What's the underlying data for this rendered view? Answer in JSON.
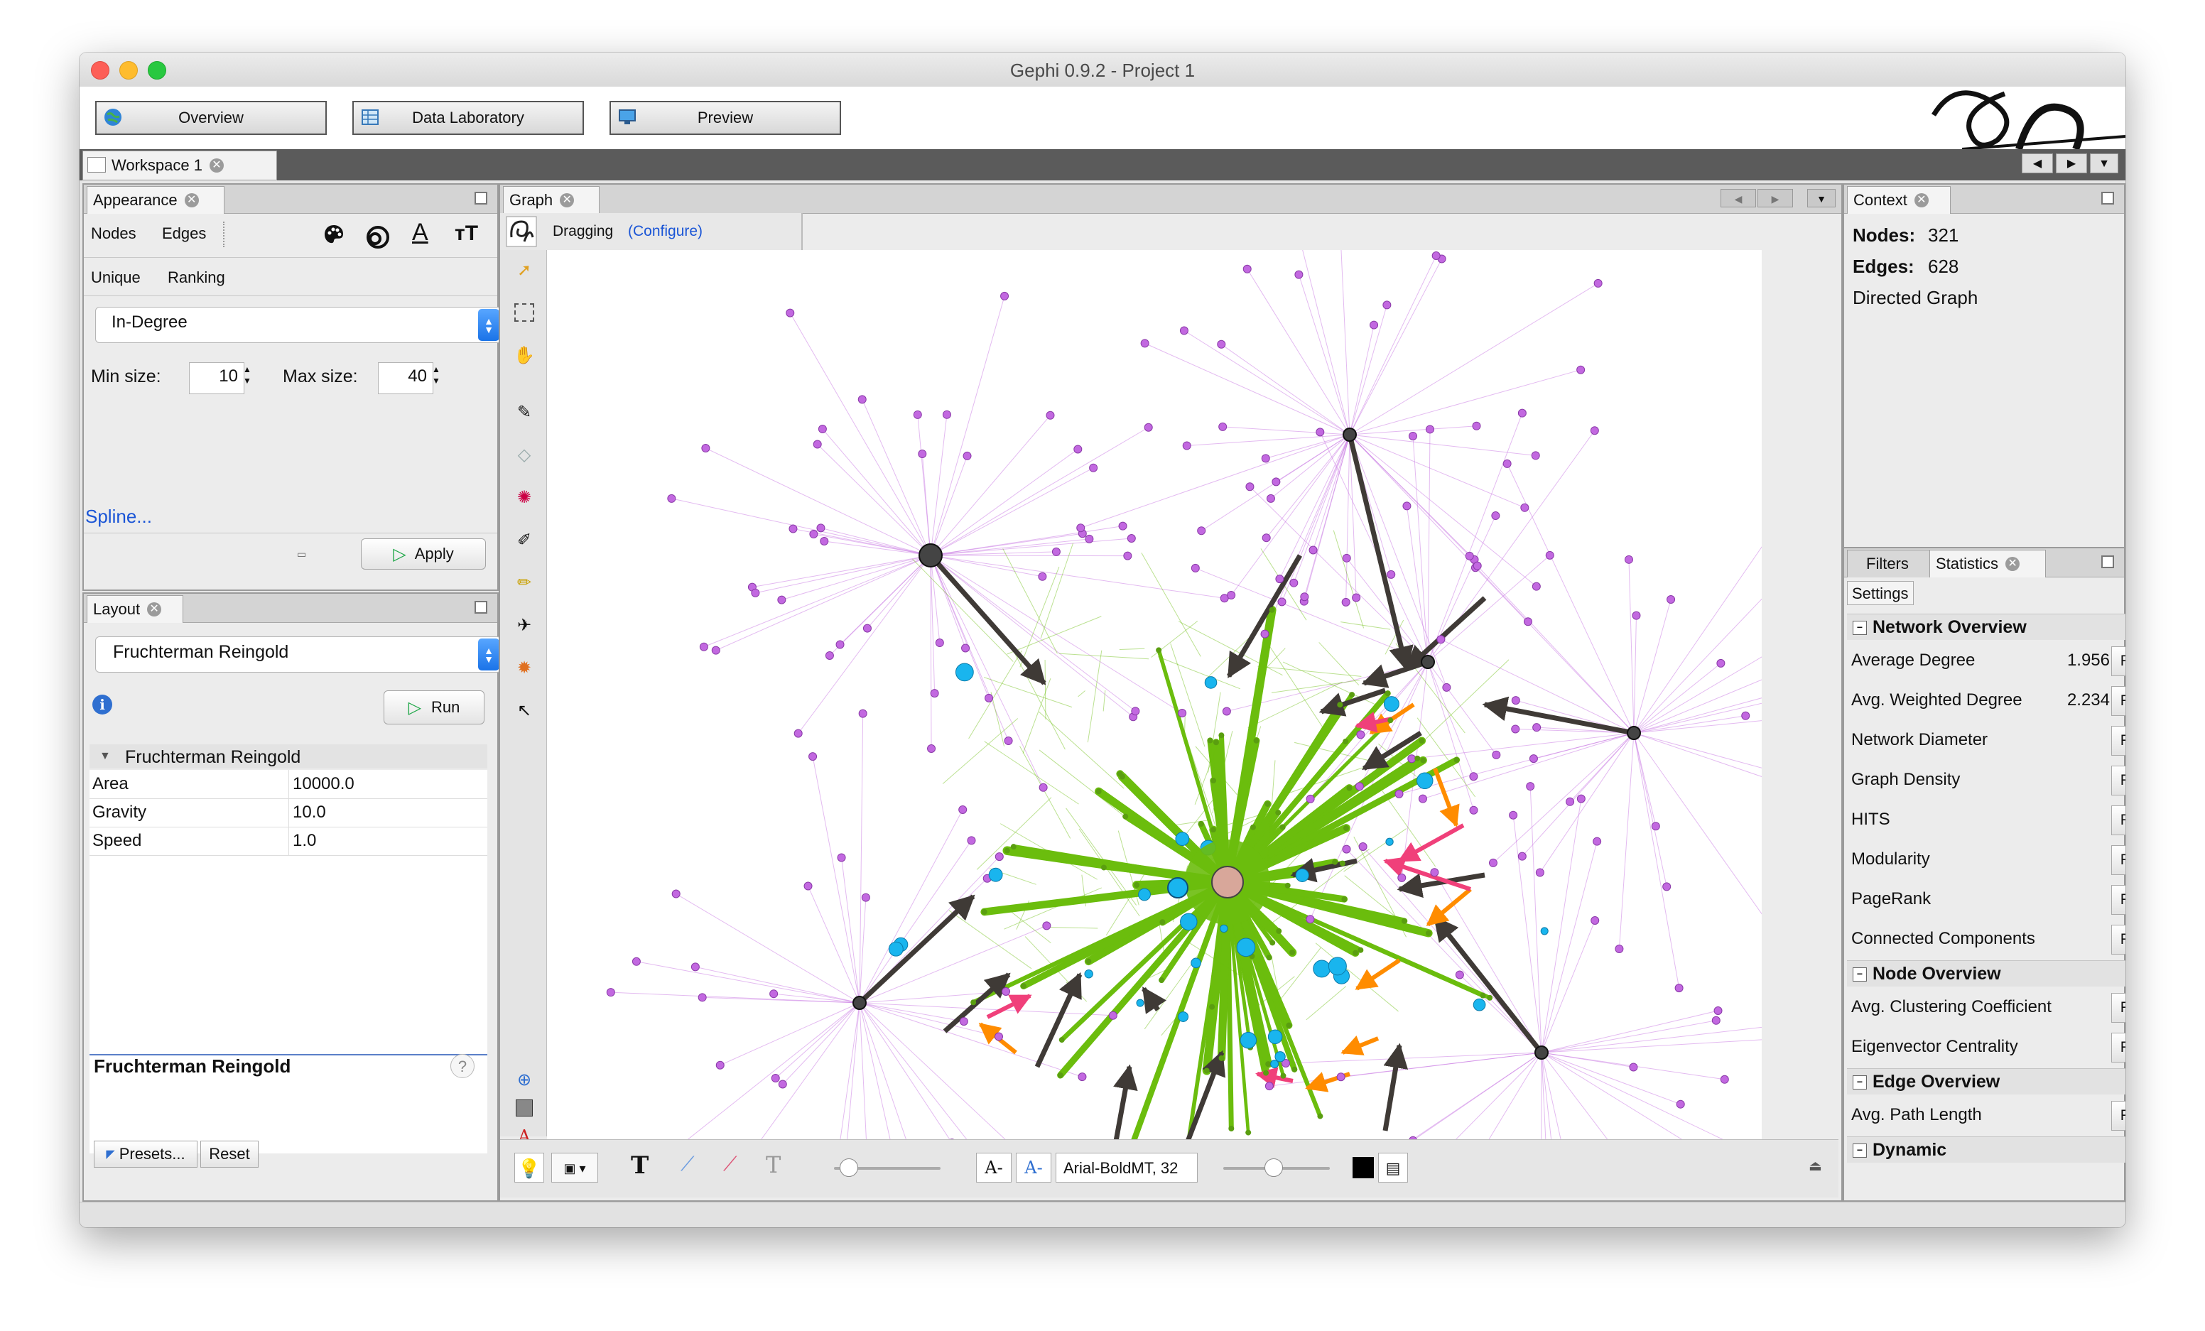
{
  "app": {
    "title": "Gephi 0.9.2 - Project 1",
    "modes": [
      "Overview",
      "Data Laboratory",
      "Preview"
    ],
    "workspace_tab": "Workspace 1"
  },
  "appearance": {
    "tab": "Appearance",
    "element_tabs": [
      "Nodes",
      "Edges"
    ],
    "sub_tabs": [
      "Unique",
      "Ranking"
    ],
    "attribute": "In-Degree",
    "min_size_label": "Min size:",
    "min_size": "10",
    "max_size_label": "Max size:",
    "max_size": "40",
    "spline_link": "Spline...",
    "apply": "Apply"
  },
  "layout": {
    "tab": "Layout",
    "algorithm": "Fruchterman Reingold",
    "run": "Run",
    "section": "Fruchterman Reingold",
    "properties": [
      {
        "name": "Area",
        "value": "10000.0"
      },
      {
        "name": "Gravity",
        "value": "10.0"
      },
      {
        "name": "Speed",
        "value": "1.0"
      }
    ],
    "description_title": "Fruchterman Reingold",
    "presets": "Presets...",
    "reset": "Reset"
  },
  "graph": {
    "tab": "Graph",
    "mode": "Dragging",
    "configure": "(Configure)",
    "font_label": "Arial-BoldMT, 32"
  },
  "context": {
    "tab": "Context",
    "nodes_label": "Nodes:",
    "nodes": "321",
    "edges_label": "Edges:",
    "edges": "628",
    "graph_type": "Directed Graph"
  },
  "statistics": {
    "tabs": [
      "Filters",
      "Statistics"
    ],
    "settings": "Settings",
    "run_label": "Run",
    "sections": [
      {
        "title": "Network Overview",
        "items": [
          {
            "name": "Average Degree",
            "value": "1.956"
          },
          {
            "name": "Avg. Weighted Degree",
            "value": "2.234"
          },
          {
            "name": "Network Diameter",
            "value": ""
          },
          {
            "name": "Graph Density",
            "value": ""
          },
          {
            "name": "HITS",
            "value": ""
          },
          {
            "name": "Modularity",
            "value": ""
          },
          {
            "name": "PageRank",
            "value": ""
          },
          {
            "name": "Connected Components",
            "value": ""
          }
        ]
      },
      {
        "title": "Node Overview",
        "items": [
          {
            "name": "Avg. Clustering Coefficient",
            "value": ""
          },
          {
            "name": "Eigenvector Centrality",
            "value": ""
          }
        ]
      },
      {
        "title": "Edge Overview",
        "items": [
          {
            "name": "Avg. Path Length",
            "value": ""
          }
        ]
      },
      {
        "title": "Dynamic",
        "items": []
      }
    ]
  },
  "colors": {
    "accent": "#1a73e8",
    "node_purple": "#c268e0",
    "node_cyan": "#19b5ee",
    "edge_green": "#6bbd0d",
    "edge_dark": "#3f3a36",
    "edge_orange": "#ff8c00",
    "edge_pink": "#f0407a"
  }
}
